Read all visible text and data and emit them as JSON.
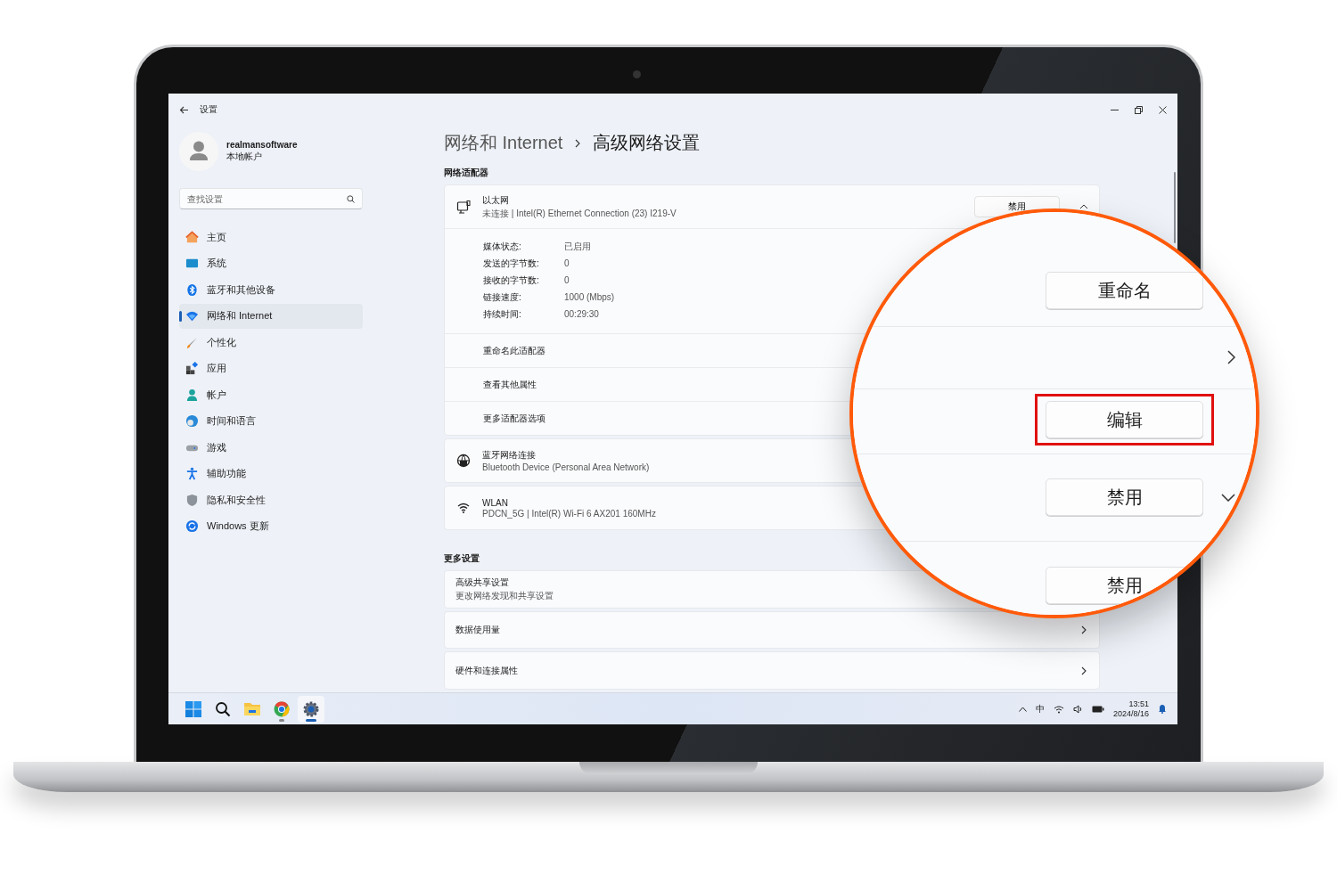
{
  "window": {
    "title": "设置"
  },
  "profile": {
    "name": "realmansoftware",
    "account_type": "本地帐户"
  },
  "search": {
    "placeholder": "查找设置"
  },
  "nav": [
    {
      "kind": "home",
      "label": "主页",
      "selected": false
    },
    {
      "kind": "system",
      "label": "系统",
      "selected": false
    },
    {
      "kind": "bluetooth",
      "label": "蓝牙和其他设备",
      "selected": false
    },
    {
      "kind": "network",
      "label": "网络和 Internet",
      "selected": true
    },
    {
      "kind": "personalize",
      "label": "个性化",
      "selected": false
    },
    {
      "kind": "apps",
      "label": "应用",
      "selected": false
    },
    {
      "kind": "accounts",
      "label": "帐户",
      "selected": false
    },
    {
      "kind": "time",
      "label": "时间和语言",
      "selected": false
    },
    {
      "kind": "gaming",
      "label": "游戏",
      "selected": false
    },
    {
      "kind": "accessibility",
      "label": "辅助功能",
      "selected": false
    },
    {
      "kind": "privacy",
      "label": "隐私和安全性",
      "selected": false
    },
    {
      "kind": "update",
      "label": "Windows 更新",
      "selected": false
    }
  ],
  "breadcrumb": [
    "网络和 Internet",
    "高级网络设置"
  ],
  "adapters_section": {
    "title": "网络适配器",
    "adapters": [
      {
        "kind": "ethernet",
        "name": "以太网",
        "detail": "未连接 | Intel(R) Ethernet Connection (23) I219-V",
        "button": "禁用",
        "expanded": true,
        "properties": [
          {
            "label": "媒体状态:",
            "value": "已启用"
          },
          {
            "label": "发送的字节数:",
            "value": "0"
          },
          {
            "label": "接收的字节数:",
            "value": "0"
          },
          {
            "label": "链接速度:",
            "value": "1000 (Mbps)"
          },
          {
            "label": "持续时间:",
            "value": "00:29:30"
          }
        ],
        "actions": [
          "重命名此适配器",
          "查看其他属性",
          "更多适配器选项"
        ]
      },
      {
        "kind": "bluetooth",
        "name": "蓝牙网络连接",
        "detail": "Bluetooth Device (Personal Area Network)"
      },
      {
        "kind": "wifi",
        "name": "WLAN",
        "detail": "PDCN_5G | Intel(R) Wi-Fi 6 AX201 160MHz"
      }
    ]
  },
  "more_settings": {
    "title": "更多设置",
    "items": [
      {
        "title": "高级共享设置",
        "subtitle": "更改网络发现和共享设置"
      },
      {
        "title": "数据使用量",
        "chevron": true
      },
      {
        "title": "硬件和连接属性",
        "chevron": true
      }
    ]
  },
  "magnifier": {
    "rows": [
      {
        "kind": "button",
        "label": "重命名",
        "highlighted": false
      },
      {
        "kind": "chevron"
      },
      {
        "kind": "button",
        "label": "编辑",
        "highlighted": true
      },
      {
        "kind": "dropdown",
        "label": "禁用",
        "highlighted": false
      },
      {
        "kind": "button",
        "label": "禁用",
        "highlighted": false
      }
    ]
  },
  "taskbar": {
    "apps": [
      {
        "kind": "start",
        "running": false,
        "active": false
      },
      {
        "kind": "search",
        "running": false,
        "active": false
      },
      {
        "kind": "explorer",
        "running": false,
        "active": false
      },
      {
        "kind": "chrome",
        "running": true,
        "active": false
      },
      {
        "kind": "settings",
        "running": true,
        "active": true
      }
    ],
    "ime": "中",
    "time": "13:51",
    "date": "2024/8/16"
  }
}
